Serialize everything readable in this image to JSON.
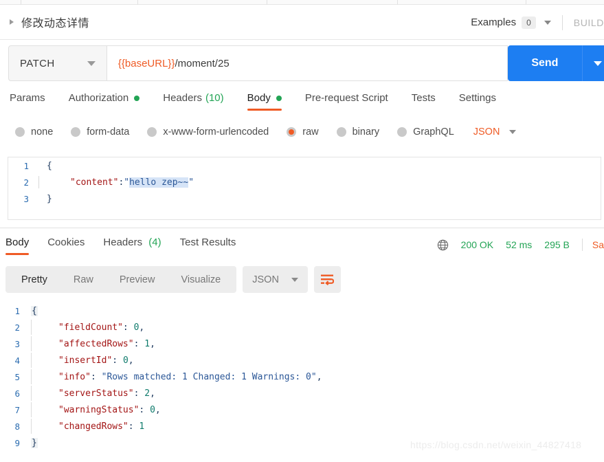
{
  "window": {
    "request_title": "修改动态详情",
    "examples_label": "Examples",
    "examples_count": "0",
    "build_label": "BUILD"
  },
  "url_bar": {
    "method": "PATCH",
    "url_variable": "{{baseURL}}",
    "url_path": "/moment/25",
    "send_label": "Send"
  },
  "request_tabs": [
    {
      "label": "Params",
      "indicator": "",
      "active": false
    },
    {
      "label": "Authorization",
      "indicator": "dot",
      "active": false
    },
    {
      "label": "Headers",
      "indicator": "(10)",
      "active": false
    },
    {
      "label": "Body",
      "indicator": "dot",
      "active": true
    },
    {
      "label": "Pre-request Script",
      "indicator": "",
      "active": false
    },
    {
      "label": "Tests",
      "indicator": "",
      "active": false
    },
    {
      "label": "Settings",
      "indicator": "",
      "active": false
    }
  ],
  "body_types": {
    "options": [
      {
        "label": "none",
        "selected": false
      },
      {
        "label": "form-data",
        "selected": false
      },
      {
        "label": "x-www-form-urlencoded",
        "selected": false
      },
      {
        "label": "raw",
        "selected": true
      },
      {
        "label": "binary",
        "selected": false
      },
      {
        "label": "GraphQL",
        "selected": false
      }
    ],
    "format": "JSON"
  },
  "request_body": {
    "lines": [
      "1",
      "2",
      "3"
    ],
    "line1": "{",
    "line2_key": "\"content\"",
    "line2_colon": ": ",
    "line2_quote_open": "\"",
    "line2_value": "hello zep~~",
    "line2_quote_close": "\"",
    "line3": "}"
  },
  "response_tabs": [
    {
      "label": "Body",
      "indicator": "",
      "active": true
    },
    {
      "label": "Cookies",
      "indicator": "",
      "active": false
    },
    {
      "label": "Headers",
      "indicator": "(4)",
      "active": false
    },
    {
      "label": "Test Results",
      "indicator": "",
      "active": false
    }
  ],
  "response_meta": {
    "status": "200 OK",
    "time": "52 ms",
    "size": "295 B",
    "save_label": "Sa"
  },
  "response_toolbar": {
    "segments": [
      {
        "label": "Pretty",
        "active": true
      },
      {
        "label": "Raw",
        "active": false
      },
      {
        "label": "Preview",
        "active": false
      },
      {
        "label": "Visualize",
        "active": false
      }
    ],
    "format": "JSON"
  },
  "response_body": {
    "line_numbers": [
      "1",
      "2",
      "3",
      "4",
      "5",
      "6",
      "7",
      "8",
      "9"
    ],
    "open_brace": "{",
    "close_brace": "}",
    "entries": [
      {
        "key": "\"fieldCount\"",
        "value": "0",
        "type": "num",
        "comma": ","
      },
      {
        "key": "\"affectedRows\"",
        "value": "1",
        "type": "num",
        "comma": ","
      },
      {
        "key": "\"insertId\"",
        "value": "0",
        "type": "num",
        "comma": ","
      },
      {
        "key": "\"info\"",
        "value": "\"Rows matched: 1  Changed: 1  Warnings: 0\"",
        "type": "str",
        "comma": ","
      },
      {
        "key": "\"serverStatus\"",
        "value": "2",
        "type": "num",
        "comma": ","
      },
      {
        "key": "\"warningStatus\"",
        "value": "0",
        "type": "num",
        "comma": ","
      },
      {
        "key": "\"changedRows\"",
        "value": "1",
        "type": "num",
        "comma": ""
      }
    ]
  },
  "watermark": "https://blog.csdn.net/weixin_44827418"
}
